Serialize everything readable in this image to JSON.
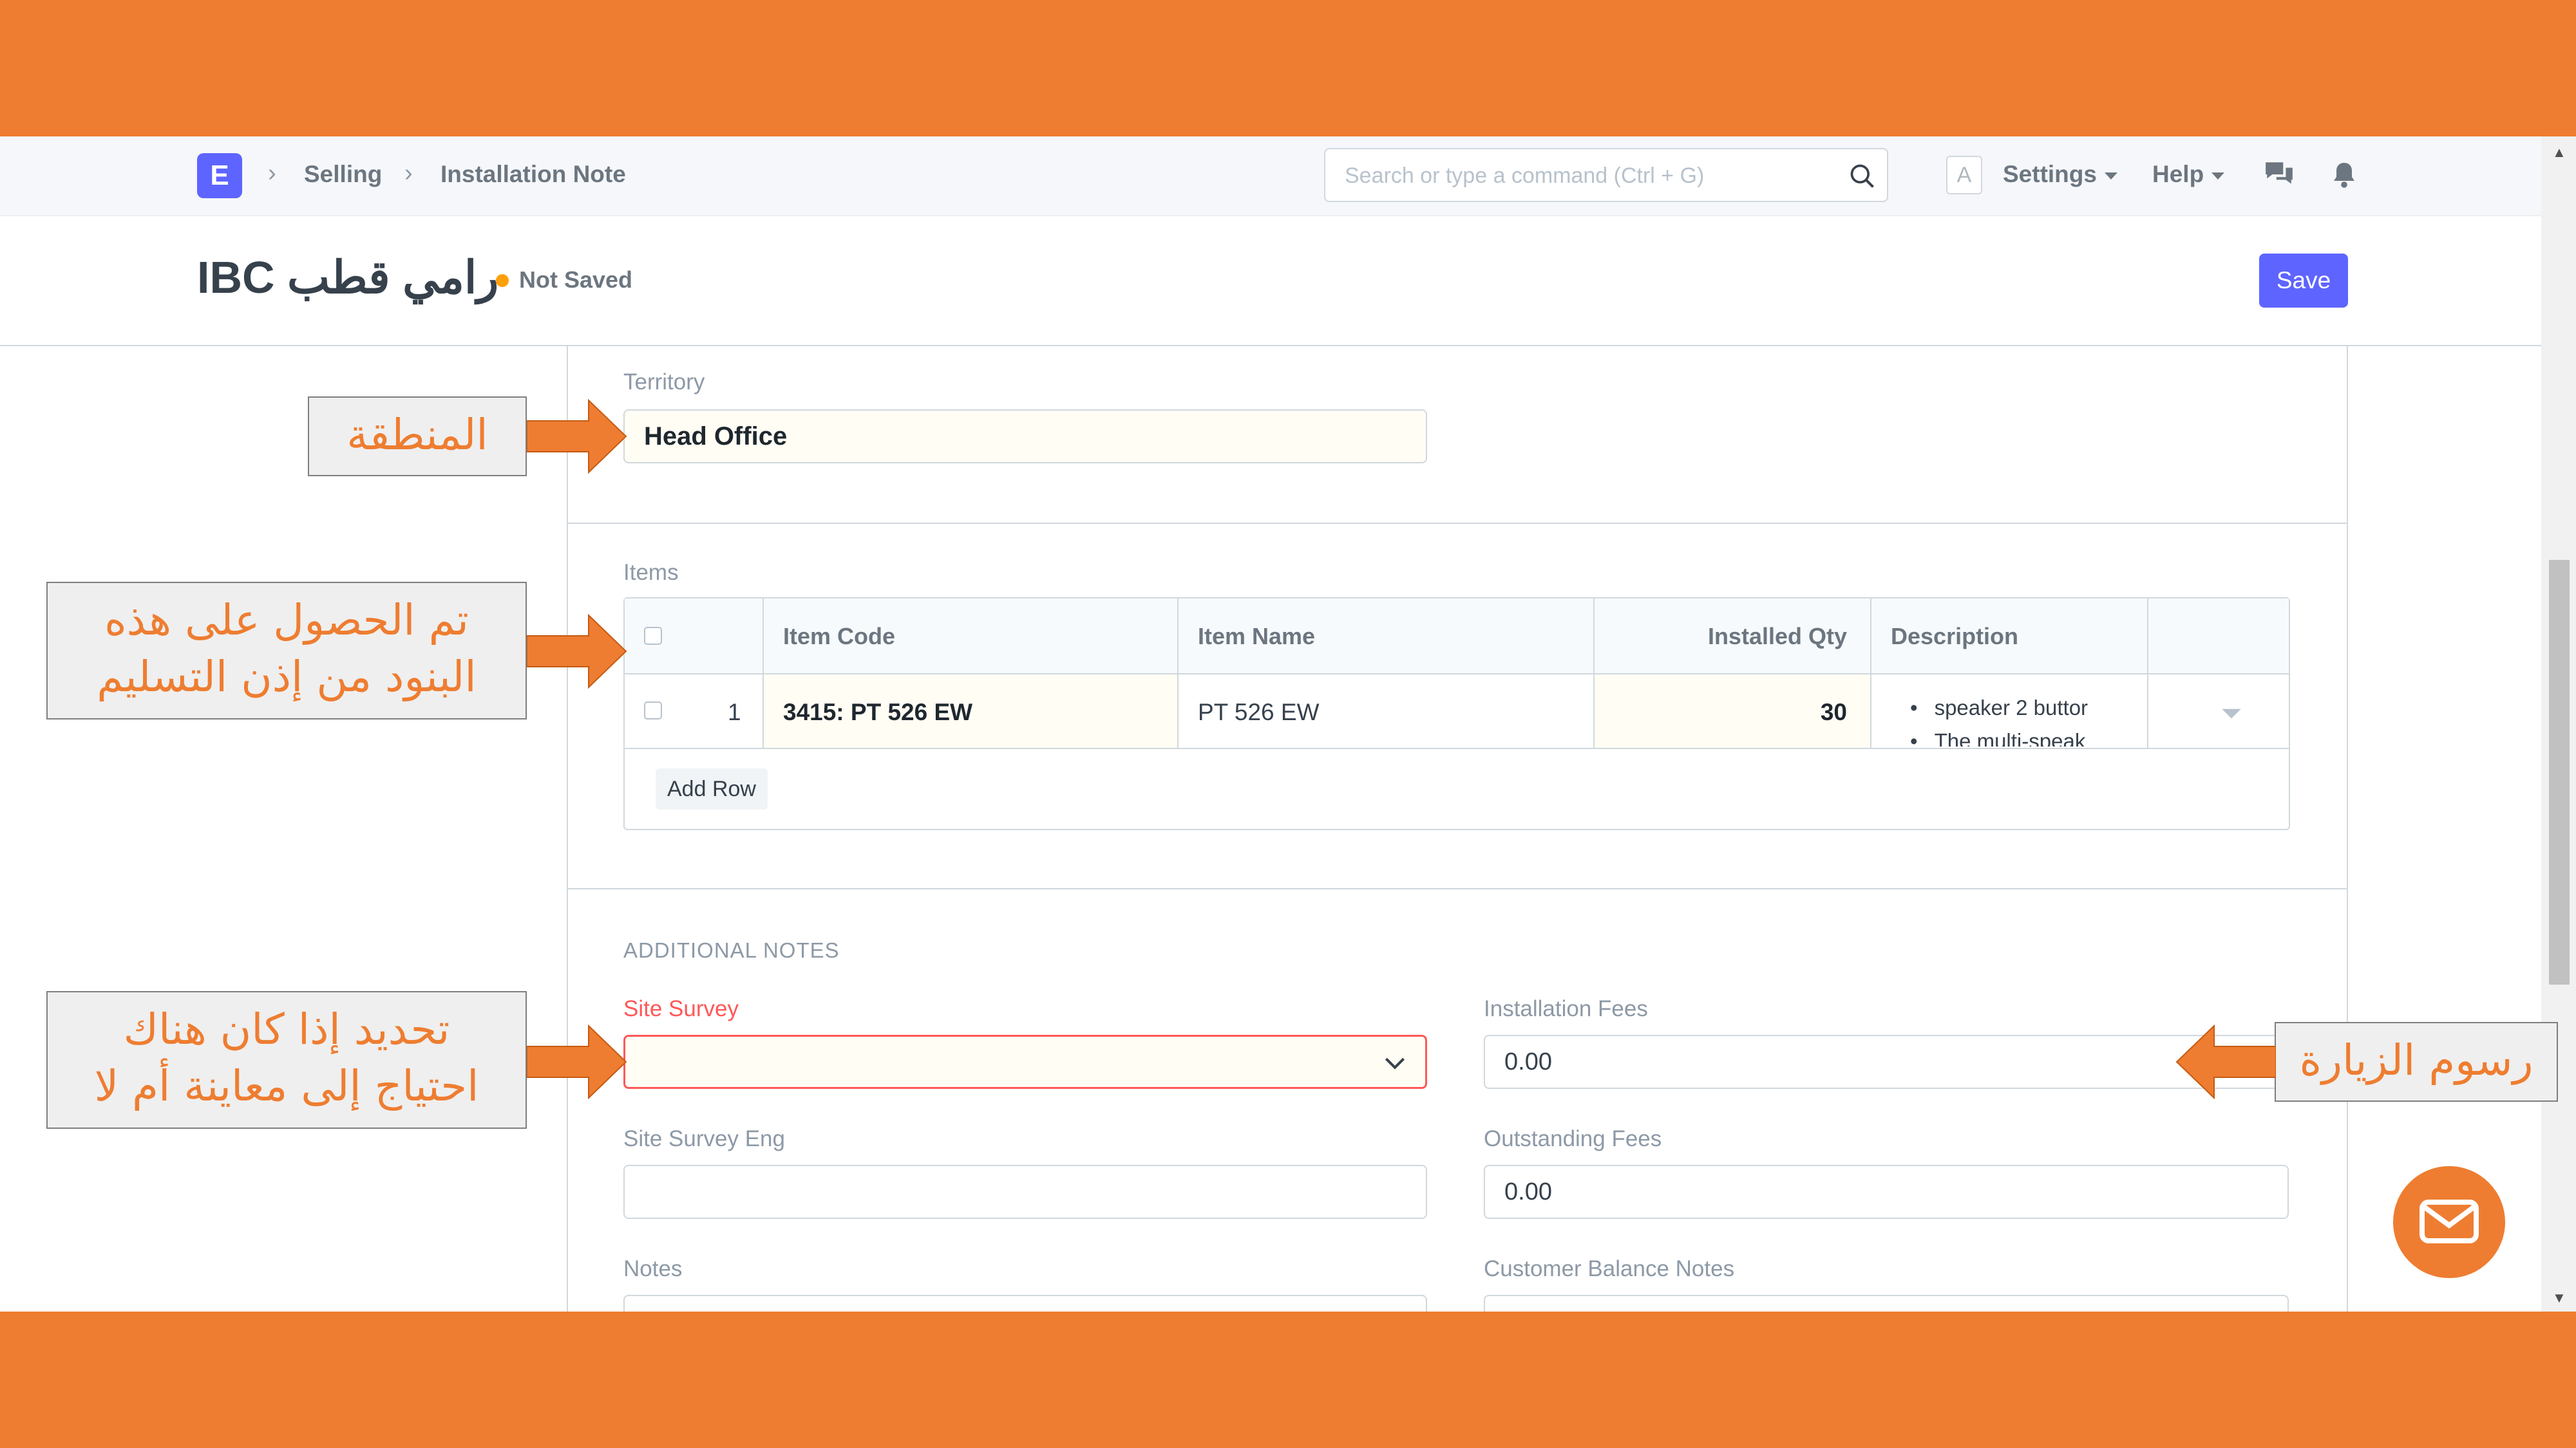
{
  "navbar": {
    "logo_letter": "E",
    "breadcrumbs": [
      "Selling",
      "Installation Note"
    ],
    "search_placeholder": "Search or type a command (Ctrl + G)",
    "avatar_letter": "A",
    "settings_label": "Settings",
    "help_label": "Help"
  },
  "page": {
    "title": "IBC رامي قطب",
    "status": "Not Saved",
    "save_label": "Save"
  },
  "form": {
    "territory_label": "Territory",
    "territory_value": "Head Office",
    "items_label": "Items",
    "grid": {
      "columns": [
        "Item Code",
        "Item Name",
        "Installed Qty",
        "Description"
      ],
      "rows": [
        {
          "idx": "1",
          "item_code": "3415: PT 526 EW",
          "item_name": "PT 526 EW",
          "installed_qty": "30",
          "description": [
            "speaker 2 buttor",
            "The multi-speak"
          ]
        }
      ],
      "add_row_label": "Add Row"
    },
    "additional_notes_heading": "ADDITIONAL NOTES",
    "site_survey_label": "Site Survey",
    "site_survey_value": "",
    "installation_fees_label": "Installation Fees",
    "installation_fees_value": "0.00",
    "site_survey_eng_label": "Site Survey Eng",
    "site_survey_eng_value": "",
    "outstanding_fees_label": "Outstanding Fees",
    "outstanding_fees_value": "0.00",
    "notes_label": "Notes",
    "customer_balance_notes_label": "Customer Balance Notes"
  },
  "annotations": {
    "territory": "المنطقة",
    "items": [
      "تم الحصول على هذه",
      "البنود من إذن التسليم"
    ],
    "site_survey": [
      "تحديد إذا كان هناك",
      "احتياج إلى معاينة أم لا"
    ],
    "installation_fees": "رسوم الزيارة"
  },
  "colors": {
    "brand_orange": "#ee7d31",
    "primary_button": "#5e64ff",
    "required_red": "#ff5858",
    "status_dot": "#ffa00a"
  }
}
